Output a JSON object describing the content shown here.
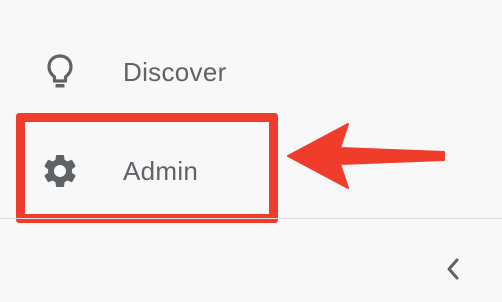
{
  "nav": {
    "items": [
      {
        "label": "Discover",
        "icon": "lightbulb-icon"
      },
      {
        "label": "Admin",
        "icon": "gear-icon"
      }
    ]
  },
  "footer": {
    "collapse_icon": "chevron-left-icon"
  },
  "annotation": {
    "highlight_color": "#f03c2a",
    "arrow_color": "#f03c2a",
    "label_color": "#5f6368"
  }
}
